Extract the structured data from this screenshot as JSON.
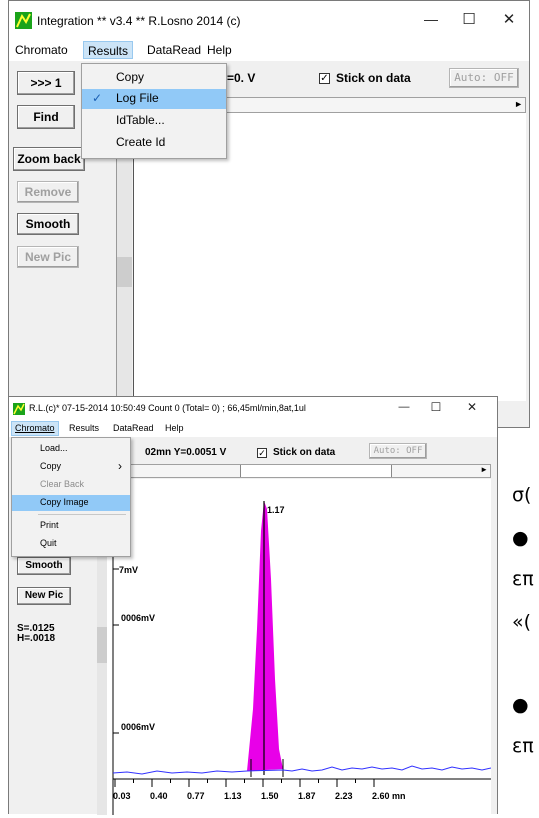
{
  "top_window": {
    "title": "Integration ** v3.4 **  R.Losno 2014 (c)",
    "controls": {
      "minimize": "—",
      "maximize": "☐",
      "close": "✕"
    },
    "menu": [
      "Chromato",
      "Results",
      "DataRead",
      "Help"
    ],
    "results_menu": {
      "items": [
        {
          "label": "Copy",
          "checked": false
        },
        {
          "label": "Log File",
          "checked": true
        },
        {
          "label": "IdTable...",
          "checked": false
        },
        {
          "label": "Create Id",
          "checked": false
        }
      ]
    },
    "buttons": {
      "next": ">>> 1",
      "find": "Find",
      "zoom_back": "Zoom back",
      "remove": "Remove",
      "smooth": "Smooth",
      "new_pic": "New Pic"
    },
    "readout": "=0. V",
    "stick_on_data": {
      "label": "Stick on data",
      "checked": true
    },
    "auto_button": "Auto: OFF",
    "scroll_arrow": "►"
  },
  "bottom_window": {
    "title": "R.L.(c)* 07-15-2014 10:50:49 Count 0 (Total= 0) ; 66,45ml/min,8at,1ul",
    "controls": {
      "minimize": "—",
      "maximize": "☐",
      "close": "✕"
    },
    "menu": [
      "Chromato",
      "Results",
      "DataRead",
      "Help"
    ],
    "chromato_menu": {
      "items": [
        {
          "label": "Load...",
          "disabled": false,
          "submenu": false
        },
        {
          "label": "Copy",
          "disabled": false,
          "submenu": true
        },
        {
          "label": "Clear Back",
          "disabled": true,
          "submenu": false
        },
        {
          "label": "Copy Image",
          "disabled": false,
          "submenu": false,
          "selected": true
        },
        {
          "label": "Print",
          "disabled": false,
          "submenu": false
        },
        {
          "label": "Quit",
          "disabled": false,
          "submenu": false
        }
      ],
      "submenu_arrow": "›"
    },
    "readout": "02mn  Y=0.0051 V",
    "stick_on_data": {
      "label": "Stick on data",
      "checked": true
    },
    "auto_button": "Auto: OFF",
    "scroll_arrow": "►",
    "buttons": {
      "smooth": "Smooth",
      "new_pic": "New Pic"
    },
    "stats": {
      "s": "S=.0125",
      "h": "H=.0018"
    },
    "y_labels": [
      "7mV",
      "0006mV",
      "0006mV"
    ],
    "peak_label": "1.17",
    "x_ticks": [
      "0.03",
      "0.40",
      "0.77",
      "1.13",
      "1.50",
      "1.87",
      "2.23",
      "2.60 mn"
    ],
    "colors": {
      "peak_fill": "#e800e8",
      "baseline": "#3030ff"
    }
  },
  "side_text": {
    "lines": [
      "σ(",
      "● ",
      "επ",
      "«(",
      "● ",
      "επ"
    ]
  }
}
